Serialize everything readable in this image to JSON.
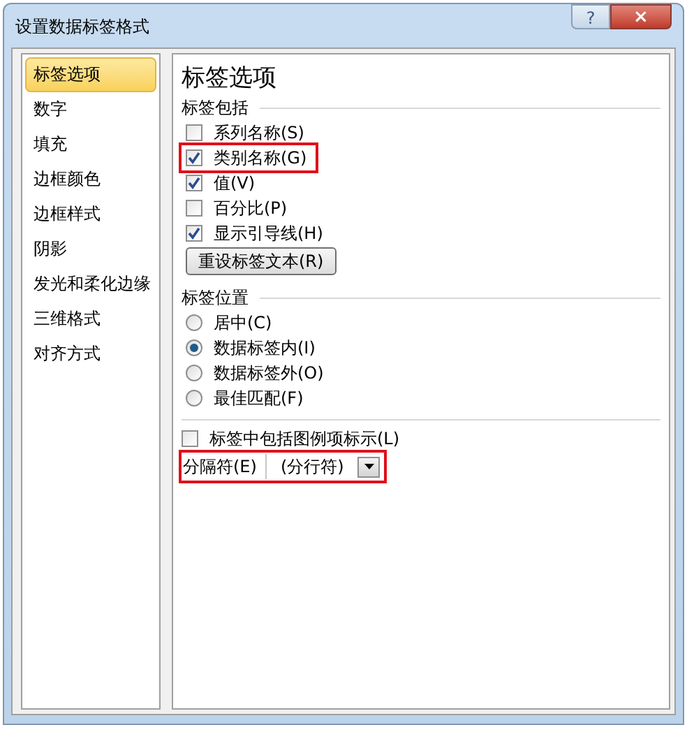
{
  "window": {
    "title": "设置数据标签格式",
    "help": "?",
    "close": "×"
  },
  "sidebar": {
    "items": [
      {
        "label": "标签选项",
        "selected": true
      },
      {
        "label": "数字",
        "selected": false
      },
      {
        "label": "填充",
        "selected": false
      },
      {
        "label": "边框颜色",
        "selected": false
      },
      {
        "label": "边框样式",
        "selected": false
      },
      {
        "label": "阴影",
        "selected": false
      },
      {
        "label": "发光和柔化边缘",
        "selected": false
      },
      {
        "label": "三维格式",
        "selected": false
      },
      {
        "label": "对齐方式",
        "selected": false
      }
    ]
  },
  "panel": {
    "title": "标签选项",
    "include": {
      "heading": "标签包括",
      "options": [
        {
          "label": "系列名称(S)",
          "checked": false,
          "highlighted": false
        },
        {
          "label": "类别名称(G)",
          "checked": true,
          "highlighted": true
        },
        {
          "label": "值(V)",
          "checked": true,
          "highlighted": false
        },
        {
          "label": "百分比(P)",
          "checked": false,
          "highlighted": false
        },
        {
          "label": "显示引导线(H)",
          "checked": true,
          "highlighted": false
        }
      ],
      "reset_button": "重设标签文本(R)"
    },
    "position": {
      "heading": "标签位置",
      "options": [
        {
          "label": "居中(C)",
          "selected": false
        },
        {
          "label": "数据标签内(I)",
          "selected": true
        },
        {
          "label": "数据标签外(O)",
          "selected": false
        },
        {
          "label": "最佳匹配(F)",
          "selected": false
        }
      ]
    },
    "legend_key": {
      "label": "标签中包括图例项标示(L)",
      "checked": false
    },
    "separator": {
      "label": "分隔符(E)",
      "value": "(分行符)",
      "highlighted": true
    }
  }
}
